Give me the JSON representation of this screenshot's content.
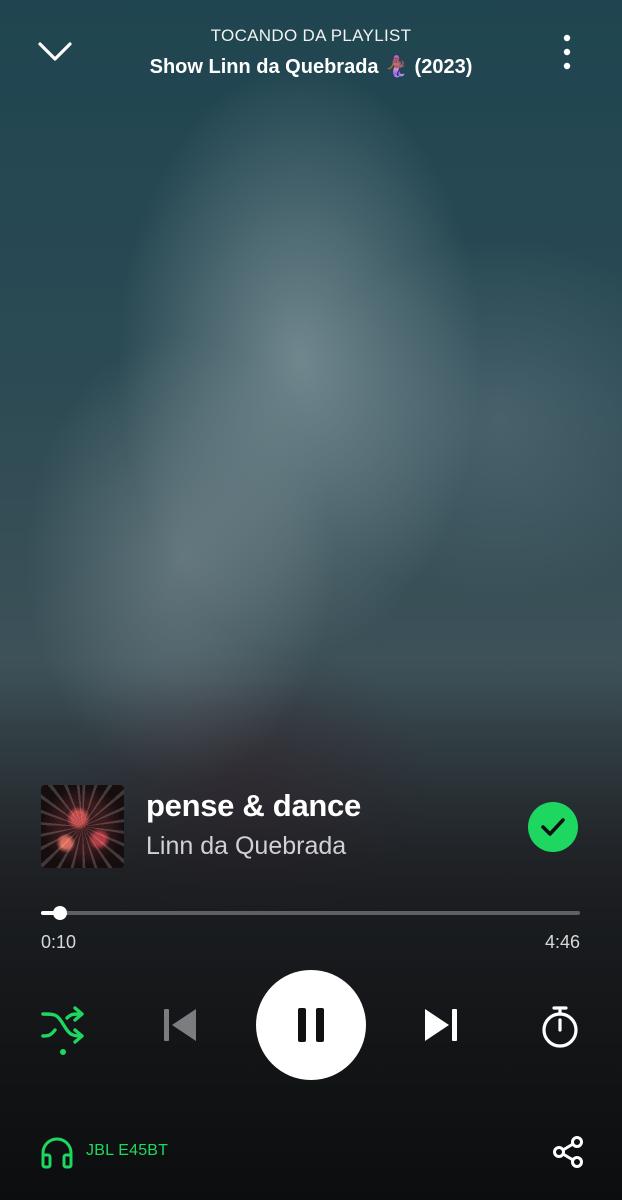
{
  "header": {
    "context_label": "TOCANDO DA PLAYLIST",
    "playlist_title": "Show Linn da Quebrada 🧜🏾‍♀️ (2023)"
  },
  "track": {
    "title": "pense & dance",
    "artist": "Linn da Quebrada",
    "liked": true
  },
  "progress": {
    "elapsed": "0:10",
    "duration": "4:46",
    "fraction": 0.036
  },
  "controls": {
    "shuffle_active": true,
    "is_playing": true
  },
  "footer": {
    "device_name": "JBL E45BT"
  },
  "colors": {
    "accent": "#1ed760",
    "text": "#ffffff"
  },
  "icons": [
    "chevron-down-icon",
    "more-vertical-icon",
    "check-icon",
    "shuffle-icon",
    "skip-previous-icon",
    "pause-icon",
    "skip-next-icon",
    "sleep-timer-icon",
    "headphones-icon",
    "share-icon"
  ]
}
